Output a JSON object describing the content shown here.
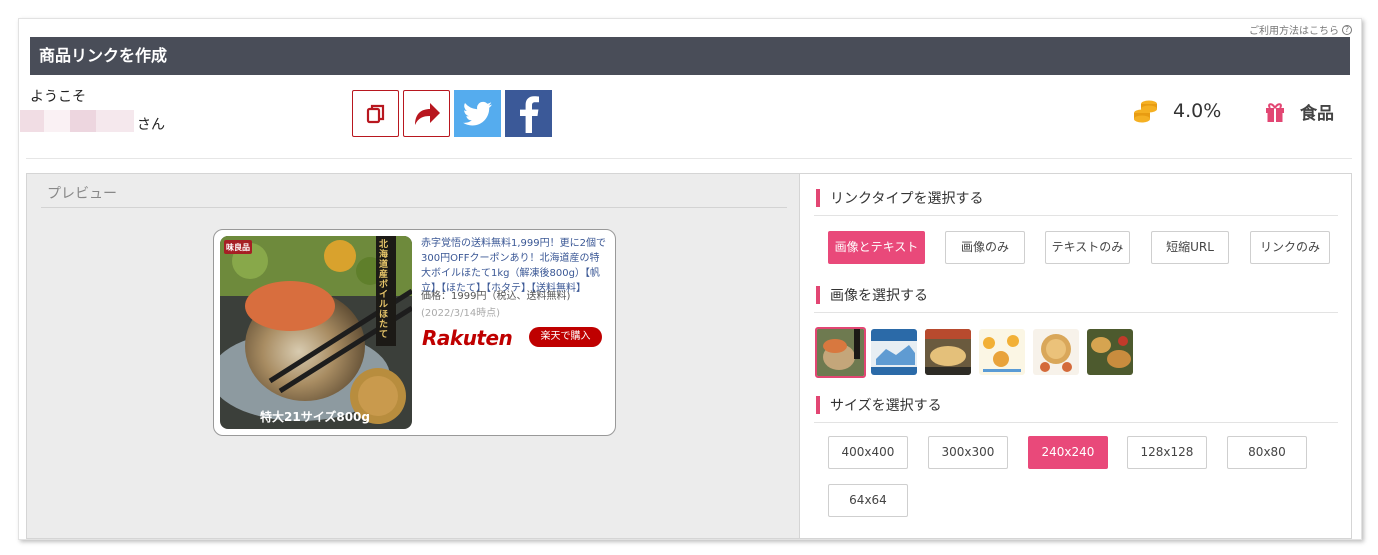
{
  "help_link": "ご利用方法はこちら",
  "title": "商品リンクを作成",
  "welcome": {
    "greeting": "ようこそ",
    "suffix": "さん"
  },
  "share": {
    "icons": [
      "copy-icon",
      "share-icon",
      "twitter-icon",
      "facebook-icon"
    ]
  },
  "reward": {
    "rate": "4.0%",
    "category": "食品"
  },
  "preview": {
    "heading": "プレビュー",
    "card": {
      "description": "赤字覚悟の送料無料1,999円！更に2個で300円OFFクーポンあり！北海道産の特大ボイルほたて1kg（解凍後800g）【帆立】【ほたて】【ホタテ】【送料無料】",
      "price": "価格：1999円（税込、送料無料)",
      "date": "(2022/3/14時点)",
      "brand": "Rakuten",
      "buy_label": "楽天で購入",
      "image_caption": "特大21サイズ800g",
      "image_banner": "北海道産ボイルほたて",
      "image_badge": "味良品"
    }
  },
  "link_type": {
    "heading": "リンクタイプを選択する",
    "options": [
      "画像とテキスト",
      "画像のみ",
      "テキストのみ",
      "短縮URL",
      "リンクのみ"
    ],
    "selected": "画像とテキスト"
  },
  "image_select": {
    "heading": "画像を選択する",
    "count": 6,
    "selected_index": 0
  },
  "size_select": {
    "heading": "サイズを選択する",
    "options": [
      "400x400",
      "300x300",
      "240x240",
      "128x128",
      "80x80",
      "64x64"
    ],
    "selected": "240x240"
  },
  "colors": {
    "accent": "#e9497a",
    "rakuten": "#bf0000",
    "header": "#494d58"
  }
}
